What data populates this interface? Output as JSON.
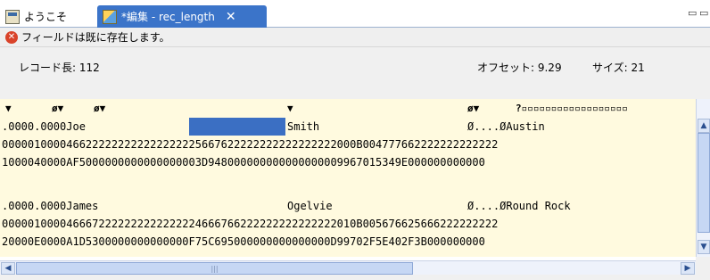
{
  "tabs": [
    {
      "label": "ようこそ",
      "icon": "welcome-icon"
    },
    {
      "label": "*編集 - rec_length",
      "icon": "edit-icon",
      "close": "✕"
    }
  ],
  "window_controls": {
    "minimize": "▭",
    "restore": "▭"
  },
  "message": {
    "text": "フィールドは既に存在します。",
    "icon_glyph": "✕"
  },
  "info": {
    "record_length": "レコード長: 112",
    "offset": "オフセット: 9.29",
    "size": "サイズ: 21"
  },
  "columns": [
    {
      "marker": "▼"
    },
    {
      "marker": "ø▼"
    },
    {
      "marker": "ø▼"
    },
    {
      "marker": "▼"
    },
    {
      "marker": "ø▼"
    },
    {
      "marker": "?▫▫▫▫▫▫▫▫▫▫▫▫▫▫▫▫▫▫"
    }
  ],
  "records": [
    {
      "text": [
        ".0000.0000Joe",
        "Smith",
        "Ø....ØAustin"
      ],
      "zone": "0000010000466222222222222222225667622222222222222222000B004777662222222222222",
      "numeric": "1000040000AF5000000000000000003D948000000000000000009967015349E000000000000"
    },
    {
      "text": [
        ".0000.0000James",
        "Ogelvie",
        "Ø....ØRound Rock"
      ],
      "zone": "0000010000466672222222222222224666766222222222222222010B005676625666222222222",
      "numeric": "20000E0000A1D5300000000000000F75C695000000000000000D99702F5E402F3B000000000"
    }
  ],
  "scroll": {
    "up": "▲",
    "down": "▼",
    "left": "◀",
    "right": "▶",
    "thumb_grip": "|||"
  },
  "colors": {
    "tab_active": "#3b74c9",
    "data_bg": "#fffadf",
    "selection": "#3b6fc3",
    "error": "#d9432a"
  }
}
